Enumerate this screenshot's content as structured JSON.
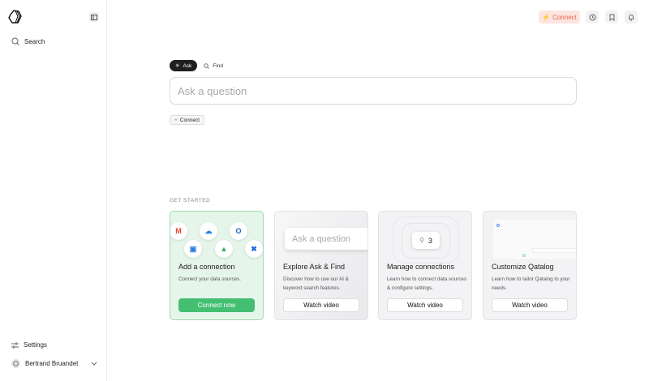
{
  "sidebar": {
    "search": "Search",
    "settings": "Settings",
    "user": "Bertrand Bruandet"
  },
  "topbar": {
    "connect": "Connect"
  },
  "modes": {
    "ask": "Ask",
    "find": "Find"
  },
  "search": {
    "placeholder": "Ask a question"
  },
  "add_connect": "Connect",
  "get_started": {
    "heading": "GET STARTED",
    "cards": [
      {
        "title": "Add a connection",
        "desc": "Connect your data sources.",
        "button": "Connect now",
        "icons": [
          "gmail",
          "onedrive",
          "outlook",
          "google-calendar",
          "google-drive",
          "confluence"
        ]
      },
      {
        "title": "Explore Ask & Find",
        "desc": "Discover how to use our AI & keyword search features.",
        "button": "Watch video",
        "preview": "Ask a question"
      },
      {
        "title": "Manage connections",
        "desc": "Learn how to connect data sources & configure settings.",
        "button": "Watch video",
        "count": "3"
      },
      {
        "title": "Customize Qatalog",
        "desc": "Learn how to tailor Qatalog to your needs.",
        "button": "Watch video"
      }
    ]
  },
  "colors": {
    "accent": "#e8674f",
    "green": "#44bf72"
  }
}
